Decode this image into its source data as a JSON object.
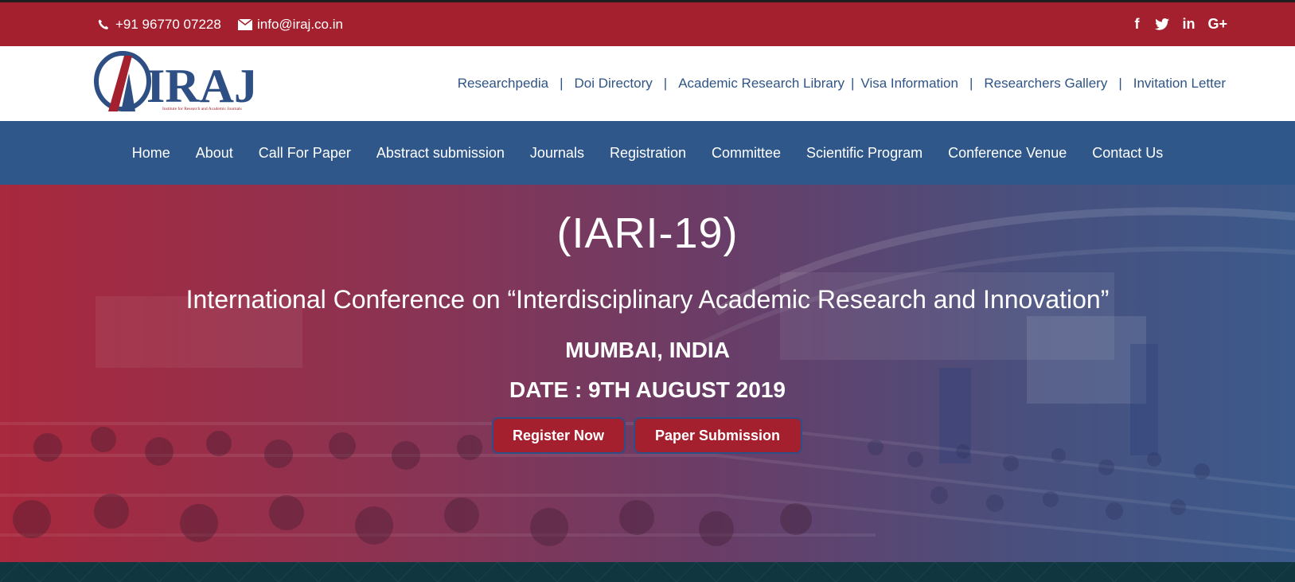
{
  "topbar": {
    "phone": "+91 96770 07228",
    "email": "info@iraj.co.in",
    "phone_icon": "phone-icon",
    "email_icon": "envelope-icon",
    "social": [
      {
        "icon": "facebook-icon",
        "glyph": "f"
      },
      {
        "icon": "twitter-icon",
        "glyph": "t"
      },
      {
        "icon": "linkedin-icon",
        "glyph": "in"
      },
      {
        "icon": "google-plus-icon",
        "glyph": "G+"
      }
    ]
  },
  "header": {
    "logo": {
      "letters": "IRAJ",
      "tagline": "Institute for Research and Academic Journals"
    },
    "links": [
      "Researchpedia",
      "Doi Directory",
      "Academic Research Library",
      "Visa Information",
      "Researchers Gallery",
      "Invitation Letter"
    ],
    "separator": "|"
  },
  "nav": [
    "Home",
    "About",
    "Call For Paper",
    "Abstract submission",
    "Journals",
    "Registration",
    "Committee",
    "Scientific Program",
    "Conference Venue",
    "Contact Us"
  ],
  "hero": {
    "title": "(IARI-19)",
    "subtitle": "International Conference on “Interdisciplinary Academic Research and Innovation”",
    "location": "MUMBAI, INDIA",
    "date": "DATE : 9TH AUGUST 2019",
    "register_label": "Register Now",
    "paper_label": "Paper Submission"
  },
  "colors": {
    "brand_red": "#a4202e",
    "brand_blue": "#2f5789",
    "link_blue": "#2e5486",
    "footer_dark": "#10363f"
  }
}
